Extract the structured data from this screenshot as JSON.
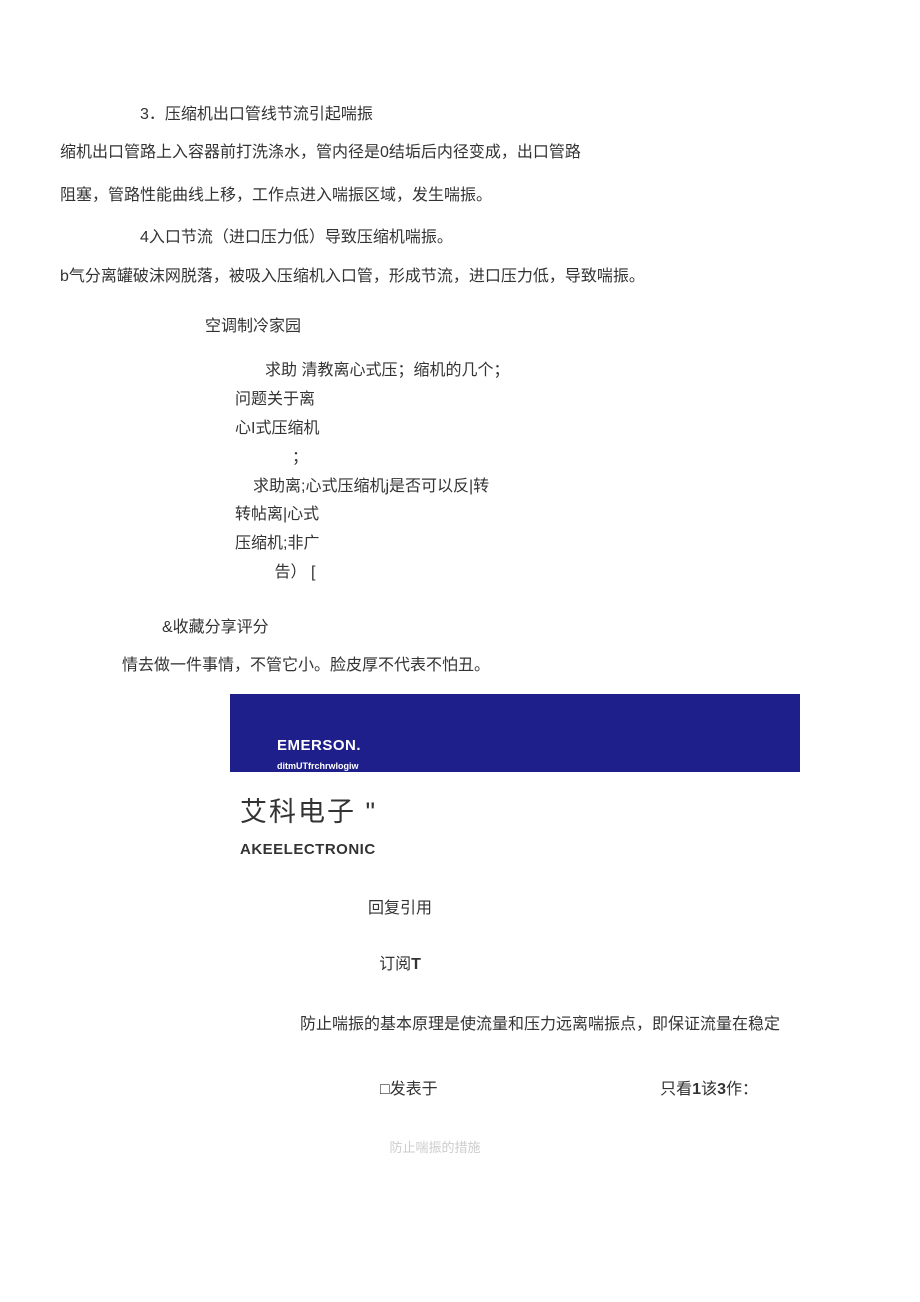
{
  "content": {
    "item3_title": "3．压缩机出口管线节流引起喘振",
    "item3_line1": "缩机出口管路上入容器前打洗涤水，管内径是0结垢后内径变成，出口管路",
    "item3_line2": "阻塞，管路性能曲线上移，工作点进入喘振区域，发生喘振。",
    "item4_title": "4入口节流（进口压力低）导致压缩机喘振。",
    "item4_line1": "b气分离罐破沫网脱落，被吸入压缩机入口管，形成节流，进口压力低，导致喘振。"
  },
  "section_title": "空调制冷家园",
  "related": {
    "line1": "求助 清教离心式压；缩机的几个；",
    "line2": "问题关于离",
    "line3": "心I式压缩机",
    "line4": "；",
    "line5": "求助离;心式压缩机j是否可以反|转",
    "line6": "转帖离|心式",
    "line7": "压缩机;非广",
    "line8": "告） ["
  },
  "actions_text": "&收藏分享评分",
  "quote_text": "情去做一件事情，不管它小。脸皮厚不代表不怕丑。",
  "banner": {
    "brand": "EMERSON.",
    "tagline": "ditmUTfrchrwlogiw"
  },
  "company": {
    "cn_name": "艾科电子 \"",
    "en_name": "AKEELECTRONIC"
  },
  "reply_quote": "回复引用",
  "subscribe_label": "订阅",
  "subscribe_suffix": "T",
  "principle": "防止喘振的基本原理是使流量和压力远离喘振点，即保证流量在稳定",
  "post_meta": {
    "published": "□发表于",
    "author_prefix": "只看",
    "author_num1": "1",
    "author_mid": "该",
    "author_num2": "3",
    "author_suffix": "作："
  },
  "cutoff": "防止喘振的措施"
}
